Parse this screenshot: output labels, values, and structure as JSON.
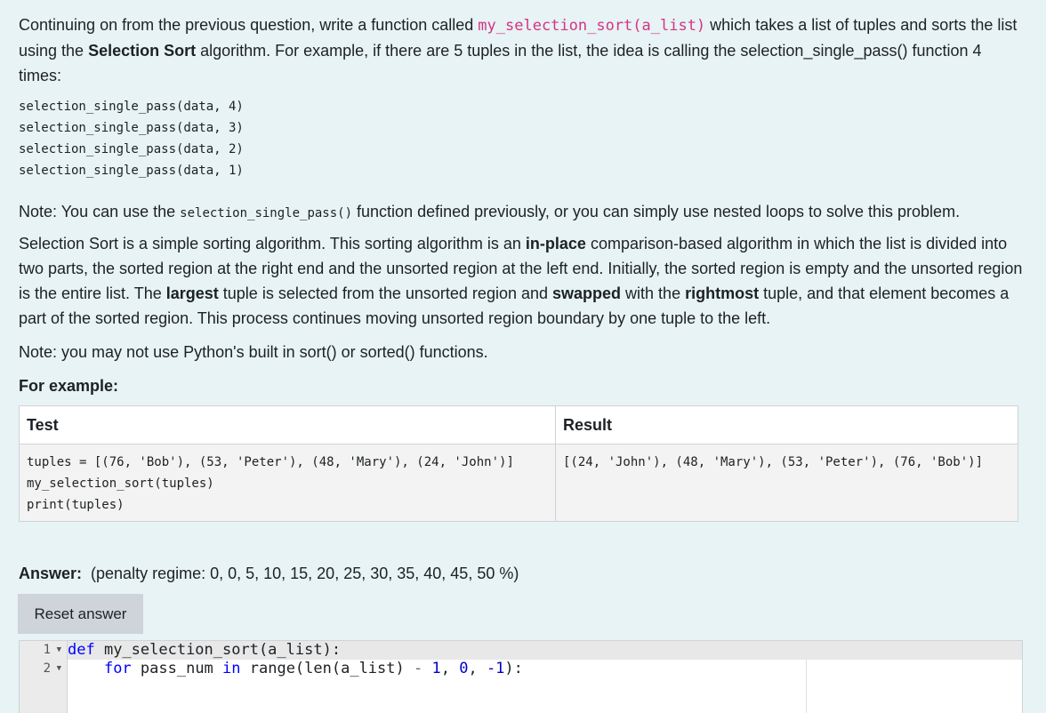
{
  "question": {
    "intro_prefix": "Continuing on from the previous question, write a function called ",
    "fn_name": "my_selection_sort(a_list)",
    "intro_mid": " which takes a list of tuples and sorts the list using the ",
    "intro_bold": "Selection Sort",
    "intro_suffix": " algorithm. For example, if there are 5 tuples in the list, the idea is calling the selection_single_pass() function 4 times:",
    "code_lines": [
      "selection_single_pass(data, 4)",
      "selection_single_pass(data, 3)",
      "selection_single_pass(data, 2)",
      "selection_single_pass(data, 1)"
    ],
    "note1_prefix": "Note: You can use the ",
    "note1_code": "selection_single_pass()",
    "note1_suffix": " function defined previously, or you can simply use nested loops to solve this problem.",
    "desc": {
      "p1": "Selection Sort is a simple sorting algorithm. This sorting algorithm is an ",
      "b1": "in-place",
      "p2": " comparison-based algorithm in which the list is divided into two parts, the sorted region at the right end and the unsorted region at the left end. Initially, the sorted region is empty and the unsorted region is the entire list. The ",
      "b2": "largest",
      "p3": " tuple is selected from the unsorted region and ",
      "b3": "swapped",
      "p4": " with the ",
      "b4": "rightmost",
      "p5": " tuple, and that element becomes a part of the sorted region. This process continues moving unsorted region boundary by one tuple to the left."
    },
    "note2": "Note: you may not use Python's built in sort() or sorted() functions.",
    "example_heading": "For example:"
  },
  "example_table": {
    "headers": [
      "Test",
      "Result"
    ],
    "test_code": "tuples = [(76, 'Bob'), (53, 'Peter'), (48, 'Mary'), (24, 'John')]\nmy_selection_sort(tuples)\nprint(tuples)",
    "result": "[(24, 'John'), (48, 'Mary'), (53, 'Peter'), (76, 'Bob')]"
  },
  "answer": {
    "label": "Answer:",
    "penalty": "(penalty regime: 0, 0, 5, 10, 15, 20, 25, 30, 35, 40, 45, 50 %)",
    "reset_label": "Reset answer"
  },
  "editor": {
    "line_numbers": [
      "1",
      "2"
    ],
    "line1": {
      "kw_def": "def",
      "rest": " my_selection_sort(a_list):"
    },
    "line2": {
      "indent": "    ",
      "kw_for": "for",
      "var": " pass_num ",
      "kw_in": "in",
      "fn": " range(len(a_list) ",
      "minus": "-",
      "num1": " 1",
      "comma1": ", ",
      "num2": "0",
      "comma2": ", ",
      "num3": "-1",
      "close": "):"
    }
  }
}
